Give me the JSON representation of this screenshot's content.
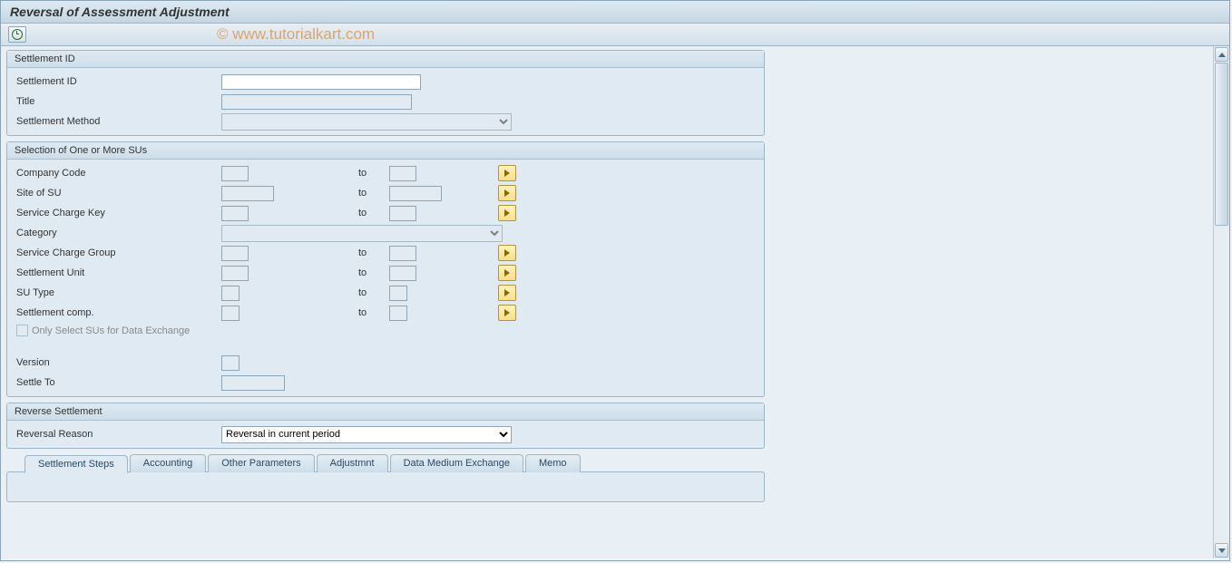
{
  "title": "Reversal of Assessment Adjustment",
  "watermark": "© www.tutorialkart.com",
  "groups": {
    "settlement_id": {
      "header": "Settlement ID",
      "fields": {
        "settlement_id": "Settlement ID",
        "title": "Title",
        "method": "Settlement Method"
      }
    },
    "selection": {
      "header": "Selection of One or More SUs",
      "company_code": "Company Code",
      "site": "Site of SU",
      "sckey": "Service Charge Key",
      "category": "Category",
      "scgroup": "Service Charge Group",
      "sunit": "Settlement Unit",
      "sutype": "SU Type",
      "scomp": "Settlement comp.",
      "only_exchange": "Only Select SUs for Data Exchange",
      "version": "Version",
      "settle_to": "Settle To",
      "to": "to"
    },
    "reverse": {
      "header": "Reverse Settlement",
      "reason_label": "Reversal Reason",
      "reason_value": "Reversal in current period"
    }
  },
  "tabs": {
    "steps": "Settlement Steps",
    "accounting": "Accounting",
    "other": "Other Parameters",
    "adjust": "Adjustmnt",
    "dme": "Data Medium Exchange",
    "memo": "Memo"
  }
}
